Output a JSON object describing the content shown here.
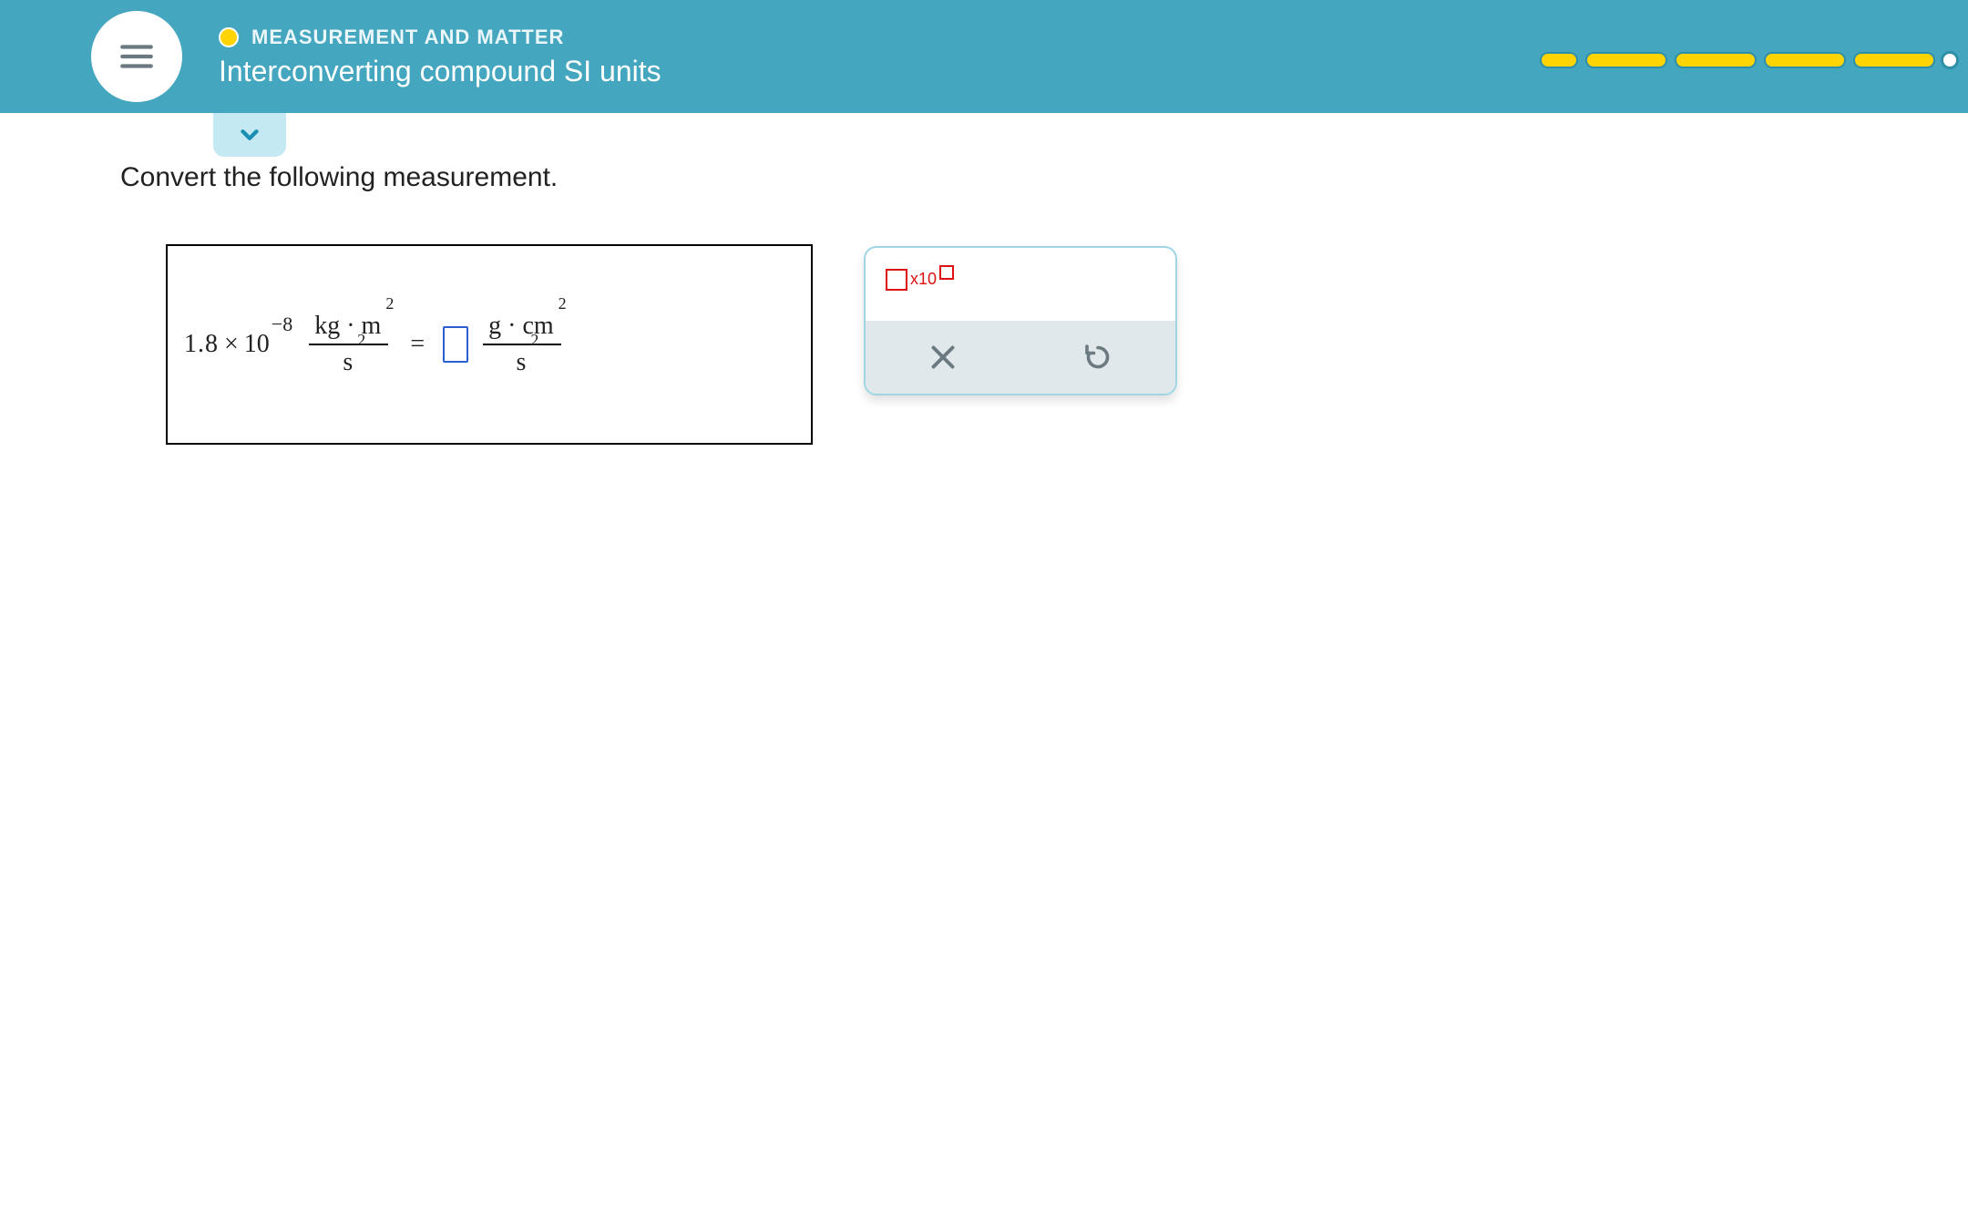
{
  "header": {
    "breadcrumb": "MEASUREMENT AND MATTER",
    "title": "Interconverting compound SI units"
  },
  "prompt": "Convert the following measurement.",
  "equation": {
    "coefficient": "1.8",
    "times": "×",
    "base": "10",
    "exponent": "−8",
    "from_unit_num_a": "kg",
    "from_unit_num_dot": "·",
    "from_unit_num_b": "m",
    "from_unit_num_b_sup": "2",
    "from_unit_den": "s",
    "from_unit_den_sup": "2",
    "equals": "=",
    "to_unit_num_a": "g",
    "to_unit_num_dot": "·",
    "to_unit_num_b": "cm",
    "to_unit_num_b_sup": "2",
    "to_unit_den": "s",
    "to_unit_den_sup": "2"
  },
  "palette": {
    "sci_label": "x10"
  }
}
